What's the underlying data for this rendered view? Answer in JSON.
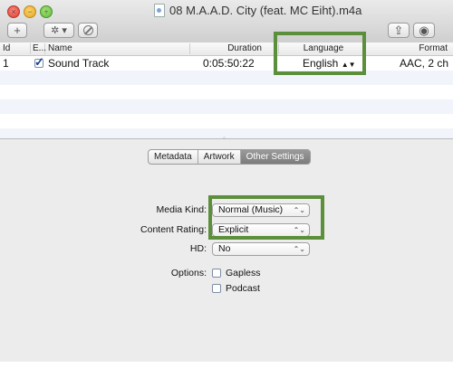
{
  "window": {
    "title": "08 M.A.A.D. City (feat. MC Eiht).m4a",
    "close_glyph": "×",
    "minimize_glyph": "−",
    "zoom_glyph": "+"
  },
  "toolbar": {
    "add_glyph": "+",
    "gear_glyph": "✲ ▾",
    "share_glyph": "⇪",
    "search_glyph": "◉"
  },
  "table": {
    "columns": [
      "Id",
      "E...",
      "Name",
      "Duration",
      "Language",
      "Format"
    ],
    "rows": [
      {
        "id": "1",
        "enabled": true,
        "name": "Sound Track",
        "duration": "0:05:50:22",
        "language": "English",
        "format": "AAC, 2 ch"
      }
    ]
  },
  "tabs": {
    "items": [
      "Metadata",
      "Artwork",
      "Other Settings"
    ],
    "selected": "Other Settings"
  },
  "settings": {
    "media_kind_label": "Media Kind:",
    "media_kind_value": "Normal (Music)",
    "content_rating_label": "Content Rating:",
    "content_rating_value": "Explicit",
    "hd_label": "HD:",
    "hd_value": "No",
    "options_label": "Options:",
    "options": [
      {
        "label": "Gapless",
        "checked": false
      },
      {
        "label": "Podcast",
        "checked": false
      }
    ]
  },
  "annotations": {
    "highlight_color": "#5c8f3b"
  }
}
